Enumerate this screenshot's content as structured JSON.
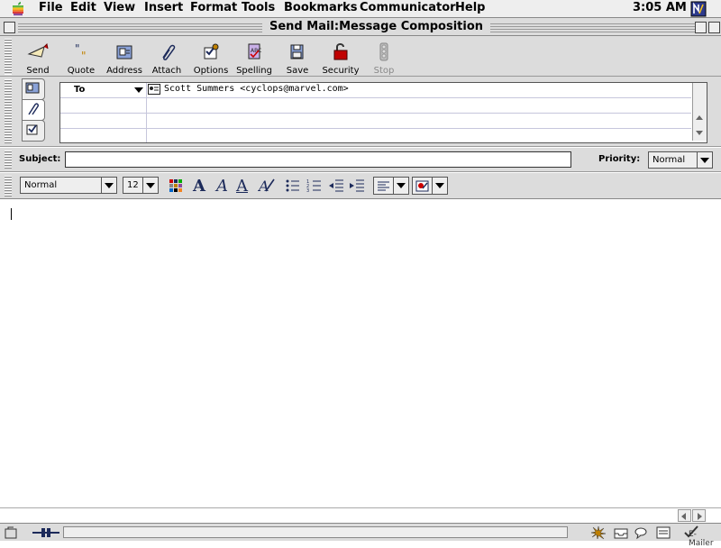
{
  "menubar": {
    "items": [
      "File",
      "Edit",
      "View",
      "Insert",
      "Format",
      "Tools",
      "Bookmarks",
      "Communicator",
      "Help"
    ],
    "clock": "3:05 AM"
  },
  "window": {
    "title": "Send Mail:Message Composition"
  },
  "toolbar": {
    "buttons": [
      {
        "label": "Send",
        "icon": "send-icon"
      },
      {
        "label": "Quote",
        "icon": "quote-icon"
      },
      {
        "label": "Address",
        "icon": "address-book-icon"
      },
      {
        "label": "Attach",
        "icon": "paperclip-icon"
      },
      {
        "label": "Options",
        "icon": "options-icon"
      },
      {
        "label": "Spelling",
        "icon": "spelling-icon"
      },
      {
        "label": "Save",
        "icon": "save-icon"
      },
      {
        "label": "Security",
        "icon": "padlock-icon"
      },
      {
        "label": "Stop",
        "icon": "stop-icon",
        "disabled": true
      }
    ]
  },
  "addressing": {
    "field_type": "To",
    "recipient": "Scott Summers <cyclops@marvel.com>"
  },
  "subject": {
    "label": "Subject:",
    "value": ""
  },
  "priority": {
    "label": "Priority:",
    "value": "Normal"
  },
  "format": {
    "style": "Normal",
    "size": "12"
  },
  "status": {
    "text": "E-Mailer"
  },
  "colors": {
    "chrome": "#dcdcdc",
    "accent": "#1c2a5a",
    "security_red": "#c00000"
  }
}
